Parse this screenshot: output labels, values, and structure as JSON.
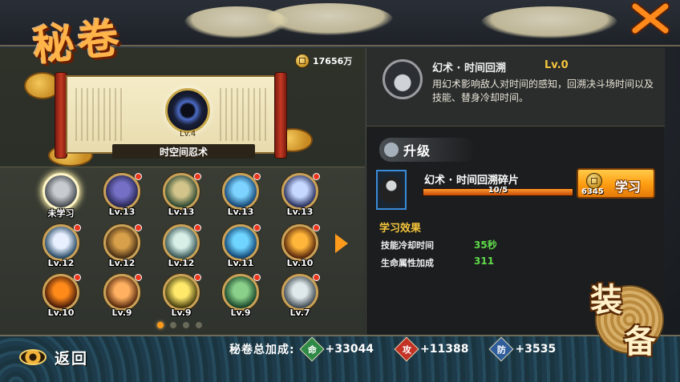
{
  "title": "秘卷",
  "money": "17656万",
  "scroll": {
    "level": "Lv.4",
    "name": "时空间忍术"
  },
  "skills": [
    {
      "level": "未学习",
      "color1": "#3b4046",
      "color2": "#c7cbcf",
      "selected": true
    },
    {
      "level": "Lv.13",
      "color1": "#21214a",
      "color2": "#7570c6"
    },
    {
      "level": "Lv.13",
      "color1": "#1f3e2a",
      "color2": "#d2c48a"
    },
    {
      "level": "Lv.13",
      "color1": "#0c3a69",
      "color2": "#7dd3ff"
    },
    {
      "level": "Lv.13",
      "color1": "#1c2352",
      "color2": "#c6d8ff"
    },
    {
      "level": "Lv.12",
      "color1": "#183c5a",
      "color2": "#e8f0ff"
    },
    {
      "level": "Lv.12",
      "color1": "#3b2410",
      "color2": "#d8a04a"
    },
    {
      "level": "Lv.12",
      "color1": "#2a4a4a",
      "color2": "#d8efe8"
    },
    {
      "level": "Lv.11",
      "color1": "#0a3a68",
      "color2": "#6fd4ff"
    },
    {
      "level": "Lv.10",
      "color1": "#4a1a08",
      "color2": "#ffb63a"
    },
    {
      "level": "Lv.10",
      "color1": "#3a1208",
      "color2": "#ff8a1a"
    },
    {
      "level": "Lv.9",
      "color1": "#4a1f08",
      "color2": "#ffb060"
    },
    {
      "level": "Lv.9",
      "color1": "#3a3208",
      "color2": "#ffe86a"
    },
    {
      "level": "Lv.9",
      "color1": "#0f3a22",
      "color2": "#8ad08a"
    },
    {
      "level": "Lv.7",
      "color1": "#354048",
      "color2": "#dfe8ea"
    }
  ],
  "pager": {
    "pages": 4,
    "active": 0
  },
  "detail": {
    "name": "幻术 · 时间回溯",
    "level": "Lv.0",
    "description": "用幻术影响敌人对时间的感知，回溯决斗场时间以及技能、替身冷却时间。"
  },
  "upgrade": {
    "tag": "升级",
    "fragment_name": "幻术 · 时间回溯碎片",
    "fragment_count": "10/5",
    "progress": 1.0,
    "learn_label": "学习",
    "learn_cost": "6345"
  },
  "effects": {
    "title": "学习效果",
    "rows": [
      {
        "label": "技能冷却时间",
        "value": "35秒"
      },
      {
        "label": "生命属性加成",
        "value": "311"
      }
    ]
  },
  "equip": {
    "char1": "装",
    "char2": "备"
  },
  "bottom": {
    "back_label": "返回",
    "totals_label": "秘卷总加成:",
    "stats": [
      {
        "badge": "命",
        "color": "#2e8a46",
        "value": "+33044"
      },
      {
        "badge": "攻",
        "color": "#c43226",
        "value": "+11388"
      },
      {
        "badge": "防",
        "color": "#2f5d9c",
        "value": "+3535"
      }
    ]
  }
}
